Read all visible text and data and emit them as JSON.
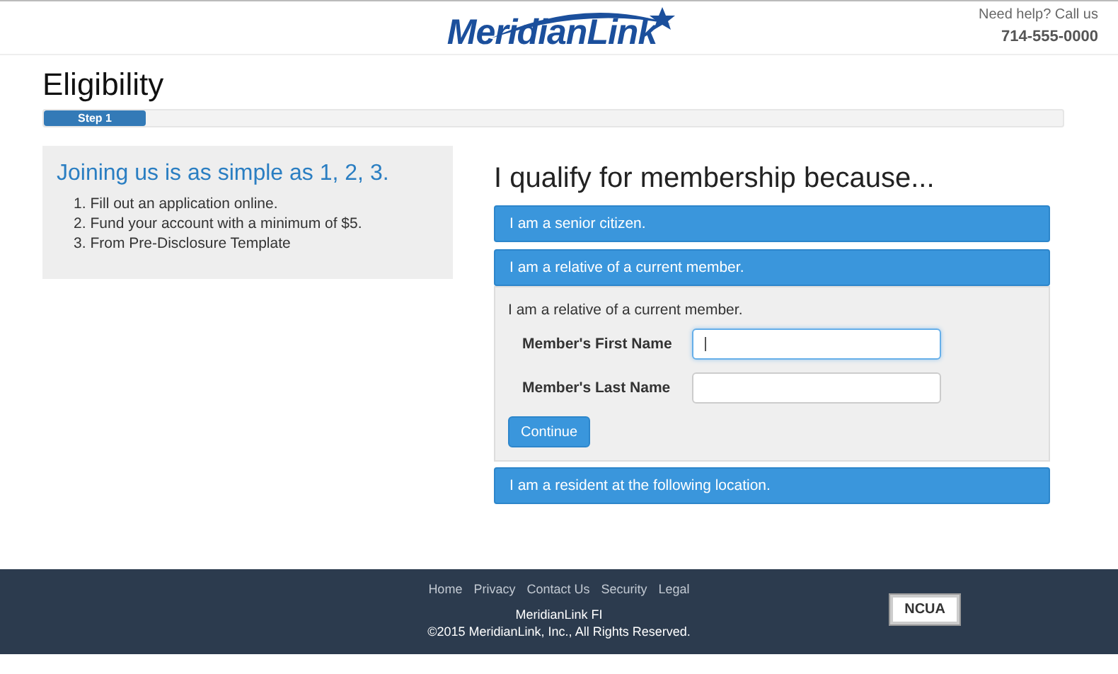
{
  "header": {
    "logo": "MeridianLink",
    "help_text": "Need help? Call us",
    "phone": "714-555-0000"
  },
  "page_title": "Eligibility",
  "progress": {
    "label": "Step 1",
    "level": 0.1
  },
  "intro": {
    "title": "Joining us is as simple as 1, 2, 3.",
    "steps": [
      {
        "number": "1.",
        "text": "Fill out an application online."
      },
      {
        "number": "2.",
        "text": "Fund your account with a minimum of $5."
      },
      {
        "number": "3.",
        "text": "From Pre-Disclosure Template"
      }
    ]
  },
  "qualify": {
    "title": "I qualify for membership because...",
    "options": [
      {
        "label": "I am a senior citizen."
      },
      {
        "label": "I am a relative of a current member.",
        "body": {
          "text": "I am a relative of a current member.",
          "fields": [
            {
              "label": "Member's First Name",
              "focused": true
            },
            {
              "label": "Member's Last Name",
              "focused": false
            }
          ],
          "button": "Continue"
        }
      },
      {
        "label": "I am a resident at the following location."
      }
    ]
  },
  "footer": {
    "links": [
      "Home",
      "Privacy",
      "Contact Us",
      "Security",
      "Legal"
    ],
    "name": "MeridianLink FI",
    "copyright": "©2015 MeridianLink, Inc., All Rights Reserved.",
    "badge": "NCUA"
  }
}
